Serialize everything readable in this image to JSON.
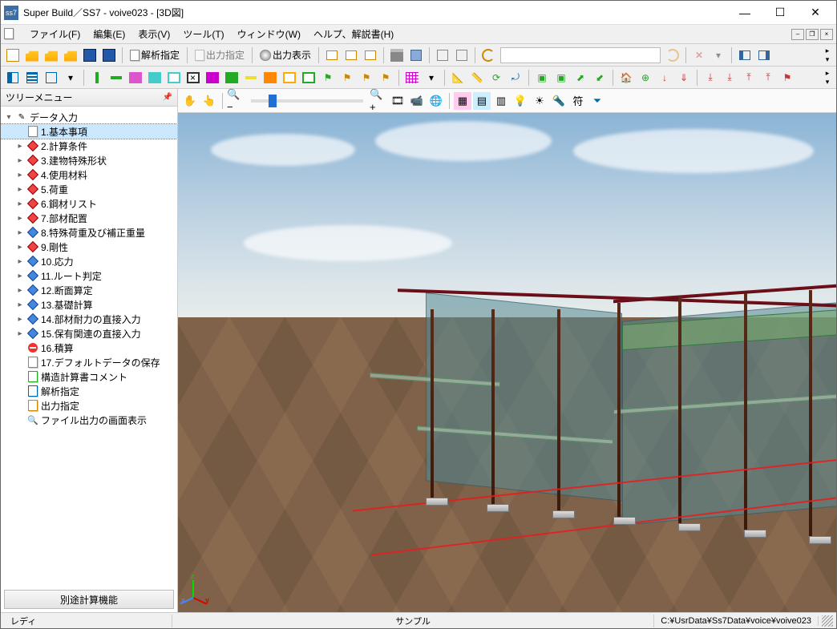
{
  "title": "Super Build／SS7 - voive023 - [3D図]",
  "app_icon_text": "ss7",
  "menu": {
    "file": "ファイル(F)",
    "edit": "編集(E)",
    "view": "表示(V)",
    "tool": "ツール(T)",
    "window": "ウィンドウ(W)",
    "help": "ヘルプ、解説書(H)"
  },
  "toolbar_labels": {
    "analysis": "解析指定",
    "output_spec": "出力指定",
    "output_show": "出力表示"
  },
  "tree": {
    "header": "ツリーメニュー",
    "root": "データ入力",
    "items": [
      {
        "label": "1.基本事項",
        "selected": true,
        "icon": "doc"
      },
      {
        "label": "2.計算条件",
        "icon": "red"
      },
      {
        "label": "3.建物特殊形状",
        "icon": "red"
      },
      {
        "label": "4.使用材料",
        "icon": "red"
      },
      {
        "label": "5.荷重",
        "icon": "red"
      },
      {
        "label": "6.鋼材リスト",
        "icon": "red"
      },
      {
        "label": "7.部材配置",
        "icon": "red"
      },
      {
        "label": "8.特殊荷重及び補正重量",
        "icon": "blue"
      },
      {
        "label": "9.剛性",
        "icon": "red"
      },
      {
        "label": "10.応力",
        "icon": "blue"
      },
      {
        "label": "11.ルート判定",
        "icon": "blue"
      },
      {
        "label": "12.断面算定",
        "icon": "blue"
      },
      {
        "label": "13.基礎計算",
        "icon": "blue"
      },
      {
        "label": "14.部材耐力の直接入力",
        "icon": "blue"
      },
      {
        "label": "15.保有関連の直接入力",
        "icon": "blue"
      },
      {
        "label": "16.積算",
        "icon": "noentry"
      },
      {
        "label": "17.デフォルトデータの保存",
        "icon": "doc"
      }
    ],
    "extra": [
      {
        "label": "構造計算書コメント",
        "icon": "doc-green"
      },
      {
        "label": "解析指定",
        "icon": "doc-blue"
      },
      {
        "label": "出力指定",
        "icon": "doc-yellow"
      },
      {
        "label": "ファイル出力の画面表示",
        "icon": "magnify"
      }
    ],
    "footer_button": "別途計算機能"
  },
  "viewbar": {
    "符": "符"
  },
  "status": {
    "ready": "レディ",
    "sample": "サンプル",
    "path": "C:¥UsrData¥Ss7Data¥voice¥voive023"
  },
  "axis": {
    "x": "x",
    "y": "y",
    "z": "z"
  }
}
